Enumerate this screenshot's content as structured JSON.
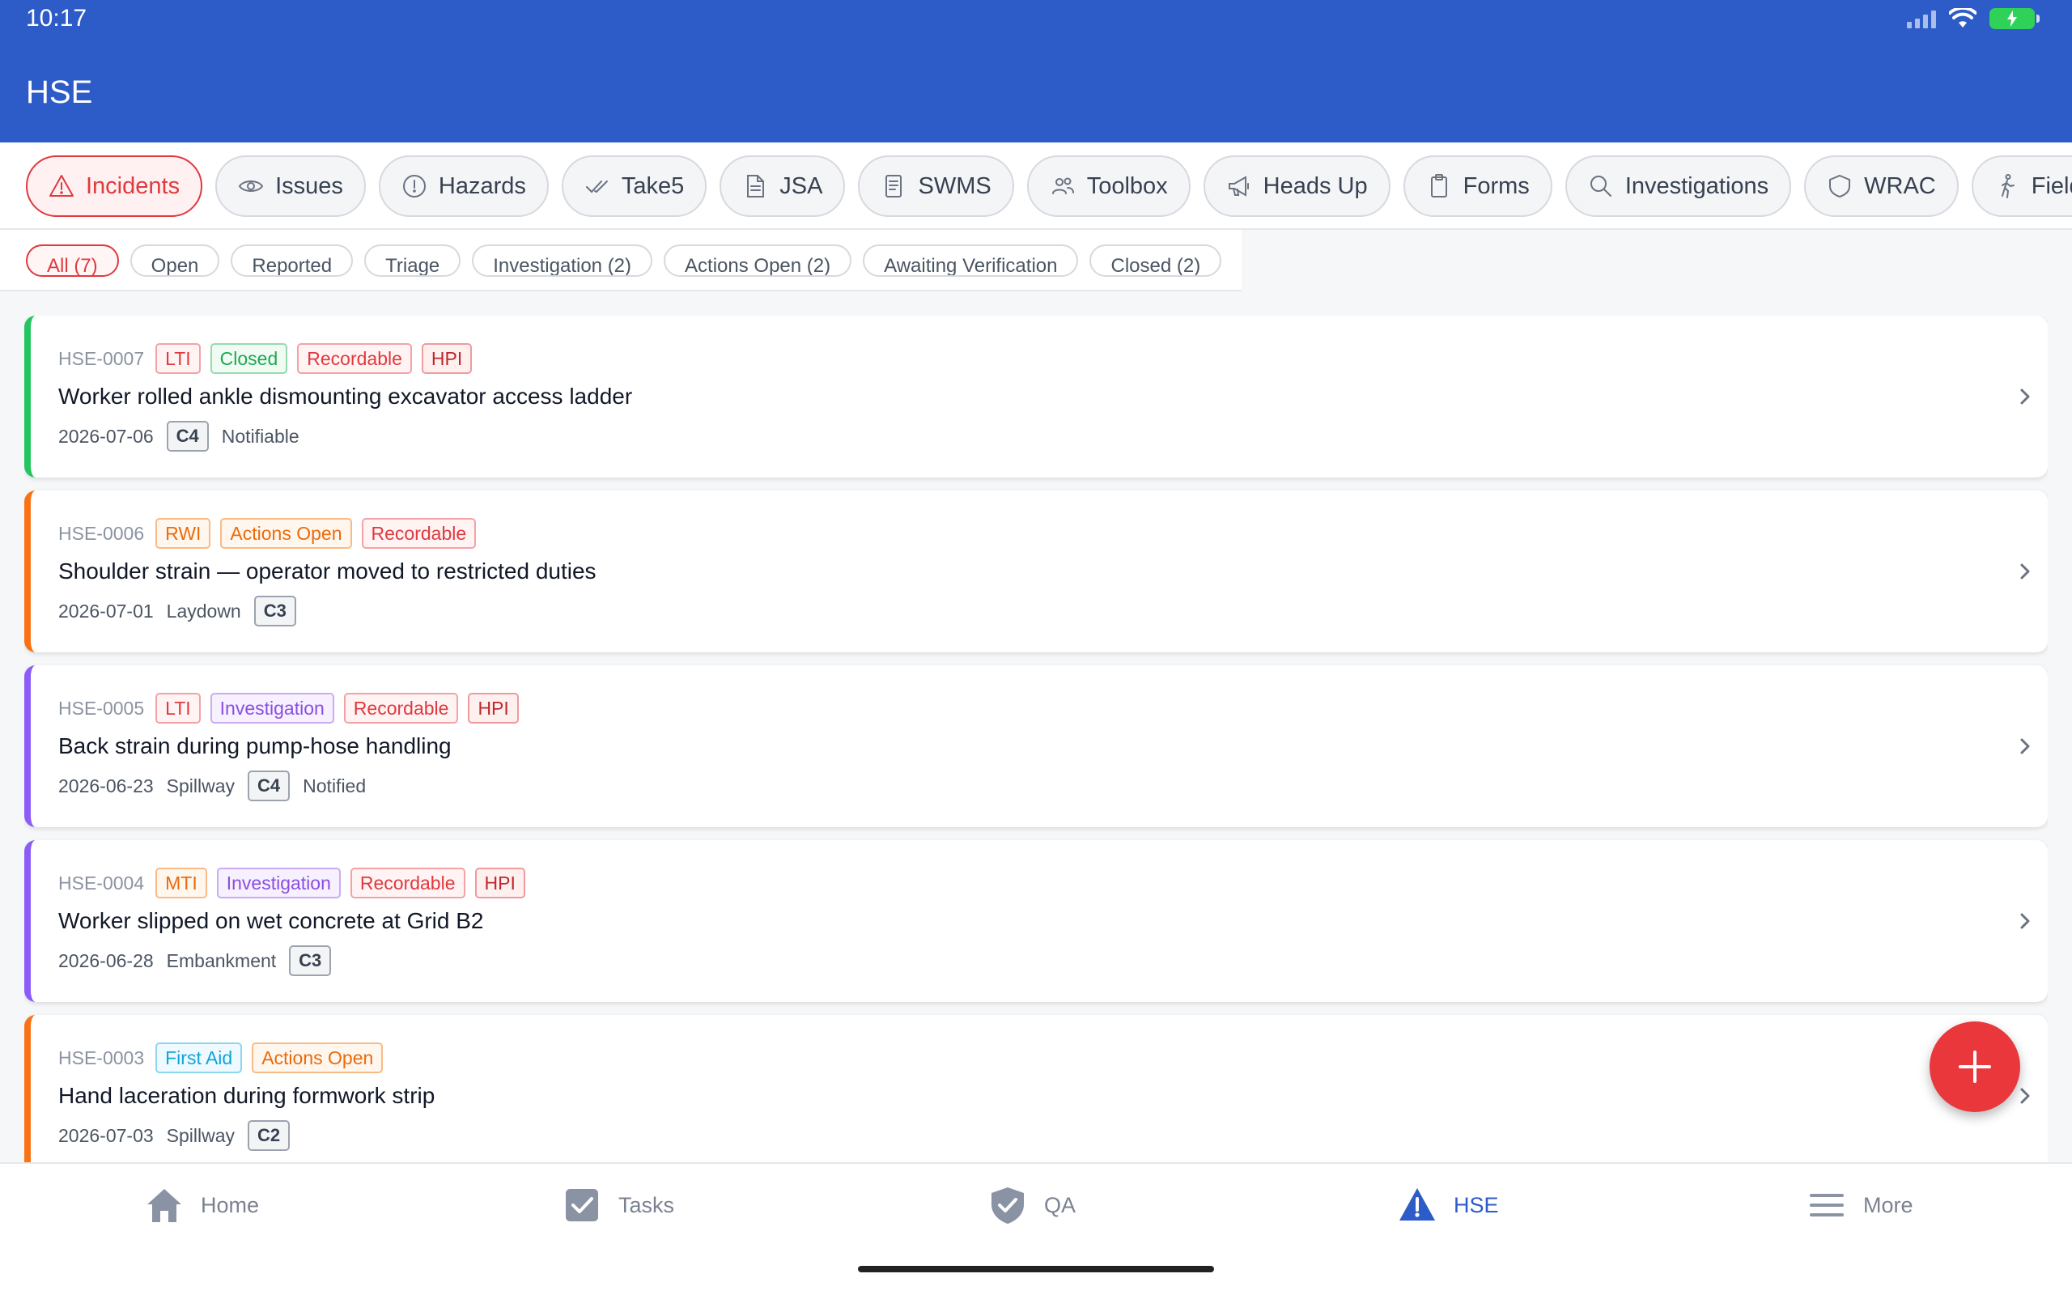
{
  "status": {
    "time": "10:17"
  },
  "app": {
    "title": "HSE"
  },
  "modules": [
    {
      "label": "Incidents",
      "icon": "warning-triangle-icon",
      "active": true
    },
    {
      "label": "Issues",
      "icon": "eye-icon"
    },
    {
      "label": "Hazards",
      "icon": "alert-circle-icon"
    },
    {
      "label": "Take5",
      "icon": "double-check-icon"
    },
    {
      "label": "JSA",
      "icon": "document-icon"
    },
    {
      "label": "SWMS",
      "icon": "clipboard-list-icon"
    },
    {
      "label": "Toolbox",
      "icon": "users-icon"
    },
    {
      "label": "Heads Up",
      "icon": "megaphone-icon"
    },
    {
      "label": "Forms",
      "icon": "clipboard-icon"
    },
    {
      "label": "Investigations",
      "icon": "search-icon"
    },
    {
      "label": "WRAC",
      "icon": "shield-icon"
    },
    {
      "label": "Field",
      "icon": "walking-person-icon"
    },
    {
      "label": "",
      "icon": "graduation-cap-icon"
    }
  ],
  "filters": [
    {
      "label": "All (7)",
      "active": true
    },
    {
      "label": "Open"
    },
    {
      "label": "Reported"
    },
    {
      "label": "Triage"
    },
    {
      "label": "Investigation (2)"
    },
    {
      "label": "Actions Open (2)"
    },
    {
      "label": "Awaiting Verification"
    },
    {
      "label": "Closed (2)"
    }
  ],
  "incidents": [
    {
      "id": "HSE-0007",
      "accent": "#22c55e",
      "badges": [
        {
          "text": "LTI",
          "style": "red"
        },
        {
          "text": "Closed",
          "style": "green"
        },
        {
          "text": "Recordable",
          "style": "red"
        },
        {
          "text": "HPI",
          "style": "darkred"
        }
      ],
      "title": "Worker rolled ankle dismounting excavator access ladder",
      "date": "2026-07-06",
      "location": "",
      "severity": "C4",
      "note": "Notifiable"
    },
    {
      "id": "HSE-0006",
      "accent": "#f97316",
      "badges": [
        {
          "text": "RWI",
          "style": "orange"
        },
        {
          "text": "Actions Open",
          "style": "orange"
        },
        {
          "text": "Recordable",
          "style": "red"
        }
      ],
      "title": "Shoulder strain — operator moved to restricted duties",
      "date": "2026-07-01",
      "location": "Laydown",
      "severity": "C3",
      "note": ""
    },
    {
      "id": "HSE-0005",
      "accent": "#8b5cf6",
      "badges": [
        {
          "text": "LTI",
          "style": "red"
        },
        {
          "text": "Investigation",
          "style": "purple"
        },
        {
          "text": "Recordable",
          "style": "red"
        },
        {
          "text": "HPI",
          "style": "darkred"
        }
      ],
      "title": "Back strain during pump-hose handling",
      "date": "2026-06-23",
      "location": "Spillway",
      "severity": "C4",
      "note": "Notified"
    },
    {
      "id": "HSE-0004",
      "accent": "#8b5cf6",
      "badges": [
        {
          "text": "MTI",
          "style": "orange"
        },
        {
          "text": "Investigation",
          "style": "purple"
        },
        {
          "text": "Recordable",
          "style": "red"
        },
        {
          "text": "HPI",
          "style": "darkred"
        }
      ],
      "title": "Worker slipped on wet concrete at Grid B2",
      "date": "2026-06-28",
      "location": "Embankment",
      "severity": "C3",
      "note": ""
    },
    {
      "id": "HSE-0003",
      "accent": "#f97316",
      "badges": [
        {
          "text": "First Aid",
          "style": "cyan"
        },
        {
          "text": "Actions Open",
          "style": "orange"
        }
      ],
      "title": "Hand laceration during formwork strip",
      "date": "2026-07-03",
      "location": "Spillway",
      "severity": "C2",
      "note": ""
    }
  ],
  "fab": {
    "icon": "plus-icon"
  },
  "nav": [
    {
      "label": "Home",
      "icon": "home-icon"
    },
    {
      "label": "Tasks",
      "icon": "checkbox-icon"
    },
    {
      "label": "QA",
      "icon": "shield-check-icon"
    },
    {
      "label": "HSE",
      "icon": "warning-triangle-icon",
      "active": true
    },
    {
      "label": "More",
      "icon": "menu-icon"
    }
  ],
  "colors": {
    "primary": "#2d5cc8",
    "danger": "#e0393e"
  }
}
